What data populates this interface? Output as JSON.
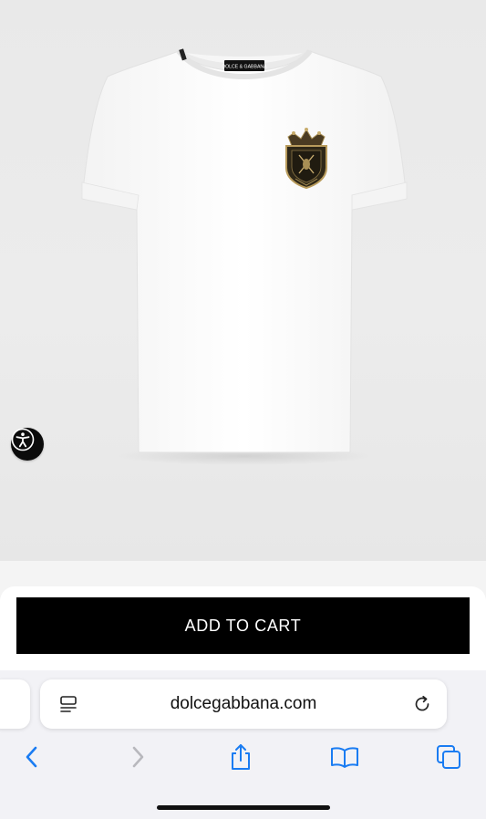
{
  "product": {
    "image_alt": "White T-shirt with crest patch",
    "neck_label_text": "DOLCE & GABBANA"
  },
  "accessibility": {
    "icon": "accessibility-icon"
  },
  "cart": {
    "add_to_cart_label": "ADD TO CART"
  },
  "browser": {
    "url": "dolcegabbana.com",
    "reader_icon": "page-menu-icon",
    "reload_icon": "reload-icon",
    "toolbar": [
      {
        "name": "back",
        "icon": "chevron-left-icon"
      },
      {
        "name": "forward",
        "icon": "chevron-right-icon"
      },
      {
        "name": "share",
        "icon": "share-icon"
      },
      {
        "name": "bookmarks",
        "icon": "book-icon"
      },
      {
        "name": "tabs",
        "icon": "tabs-icon"
      }
    ]
  },
  "colors": {
    "button_bg": "#000000",
    "button_text": "#ffffff",
    "accent_blue": "#1a7cf2",
    "disabled_gray": "#b8b8bd"
  }
}
